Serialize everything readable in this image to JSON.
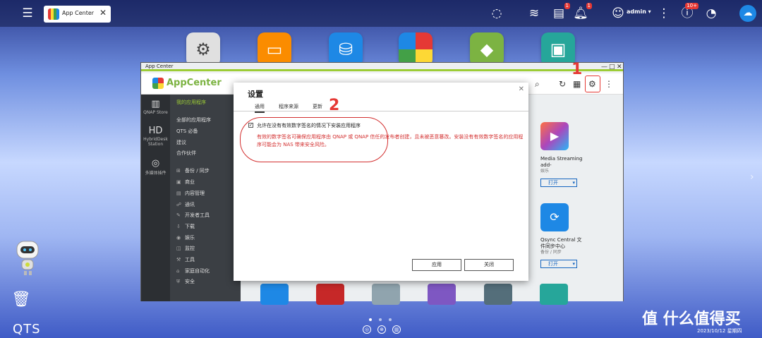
{
  "taskbar": {
    "tab_label": "App Center",
    "user": "admin ▾",
    "notif_badge": "1",
    "tasks_badge": "1",
    "info_badge": "10+"
  },
  "desktop": {
    "footer": "QTS",
    "watermark": "值 什么值得买",
    "datetime": "2023/10/12 星期四"
  },
  "window": {
    "title": "App Center",
    "app_title": "AppCenter"
  },
  "left_col": [
    {
      "label": "QNAP Store",
      "icon": "store-icon"
    },
    {
      "label": "HybridDesk Station",
      "icon": "hd-icon"
    },
    {
      "label": "多媒体插件",
      "icon": "multimedia-icon"
    }
  ],
  "nav": {
    "my_apps": "我的应用程序",
    "items": [
      "全部的应用程序",
      "QTS 必备",
      "建议",
      "合作伙伴"
    ],
    "categories": [
      "备份 / 同步",
      "商业",
      "内容管理",
      "通讯",
      "开发者工具",
      "下载",
      "娱乐",
      "监控",
      "工具",
      "家庭自动化",
      "安全"
    ]
  },
  "cards": [
    {
      "name": "Media Streaming add-",
      "cat": "娱乐",
      "btn": "打开"
    },
    {
      "name": "Qsync Central 文件同步中心",
      "cat": "备份 / 同步",
      "btn": "打开"
    }
  ],
  "modal": {
    "title": "设置",
    "tabs": [
      "通用",
      "程序来源",
      "更新"
    ],
    "checkbox_label": "允许在没有有效数字签名的情况下安装应用程序",
    "warning": "有效的数字签名可确保应用程序由 QNAP 或 QNAP 信任的发布者创建，且未被恶意篡改。安装没有有效数字签名的应用程序可能会为 NAS 带来安全风险。",
    "apply": "应用",
    "close": "关闭"
  },
  "annotations": {
    "one": "1",
    "two": "2"
  },
  "colors": {
    "accent_green": "#9ccc35",
    "annotation_red": "#e53935",
    "link_blue": "#1565c0"
  }
}
